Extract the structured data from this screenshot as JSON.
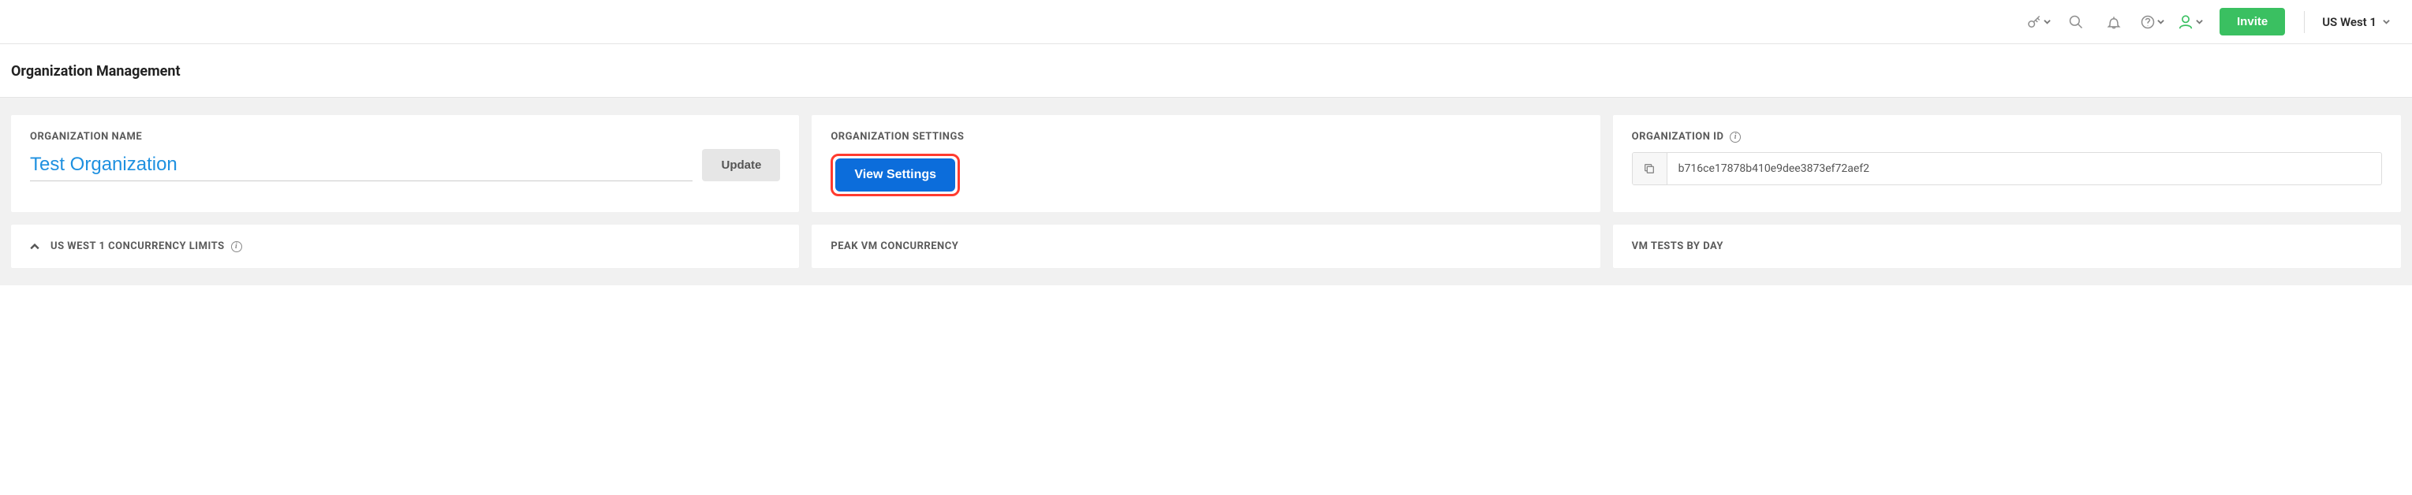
{
  "header": {
    "invite_label": "Invite",
    "region_label": "US West 1"
  },
  "page": {
    "title": "Organization Management"
  },
  "cards": {
    "org_name": {
      "label": "ORGANIZATION NAME",
      "value": "Test Organization",
      "update_label": "Update"
    },
    "org_settings": {
      "label": "ORGANIZATION SETTINGS",
      "button_label": "View Settings"
    },
    "org_id": {
      "label": "ORGANIZATION ID",
      "value": "b716ce17878b410e9dee3873ef72aef2"
    },
    "concurrency": {
      "label": "US WEST 1 CONCURRENCY LIMITS"
    },
    "peak_vm": {
      "label": "PEAK VM CONCURRENCY"
    },
    "vm_tests": {
      "label": "VM TESTS BY DAY"
    }
  }
}
